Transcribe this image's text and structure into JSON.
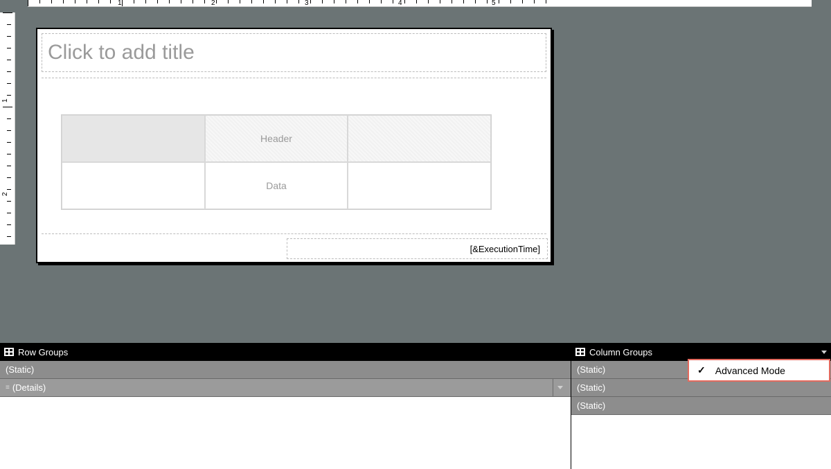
{
  "ruler": {
    "major_labels": [
      "1",
      "2",
      "3",
      "4",
      "5"
    ],
    "left_labels": [
      "1",
      "2"
    ]
  },
  "report": {
    "title_placeholder": "Click to add title",
    "matrix": {
      "header_label": "Header",
      "data_label": "Data"
    },
    "footer_expr": "[&ExecutionTime]"
  },
  "groups": {
    "row_title": "Row Groups",
    "col_title": "Column Groups",
    "row_items": [
      "(Static)",
      "(Details)"
    ],
    "col_items": [
      "(Static)",
      "(Static)",
      "(Static)"
    ]
  },
  "menu": {
    "advanced_mode": "Advanced Mode"
  }
}
